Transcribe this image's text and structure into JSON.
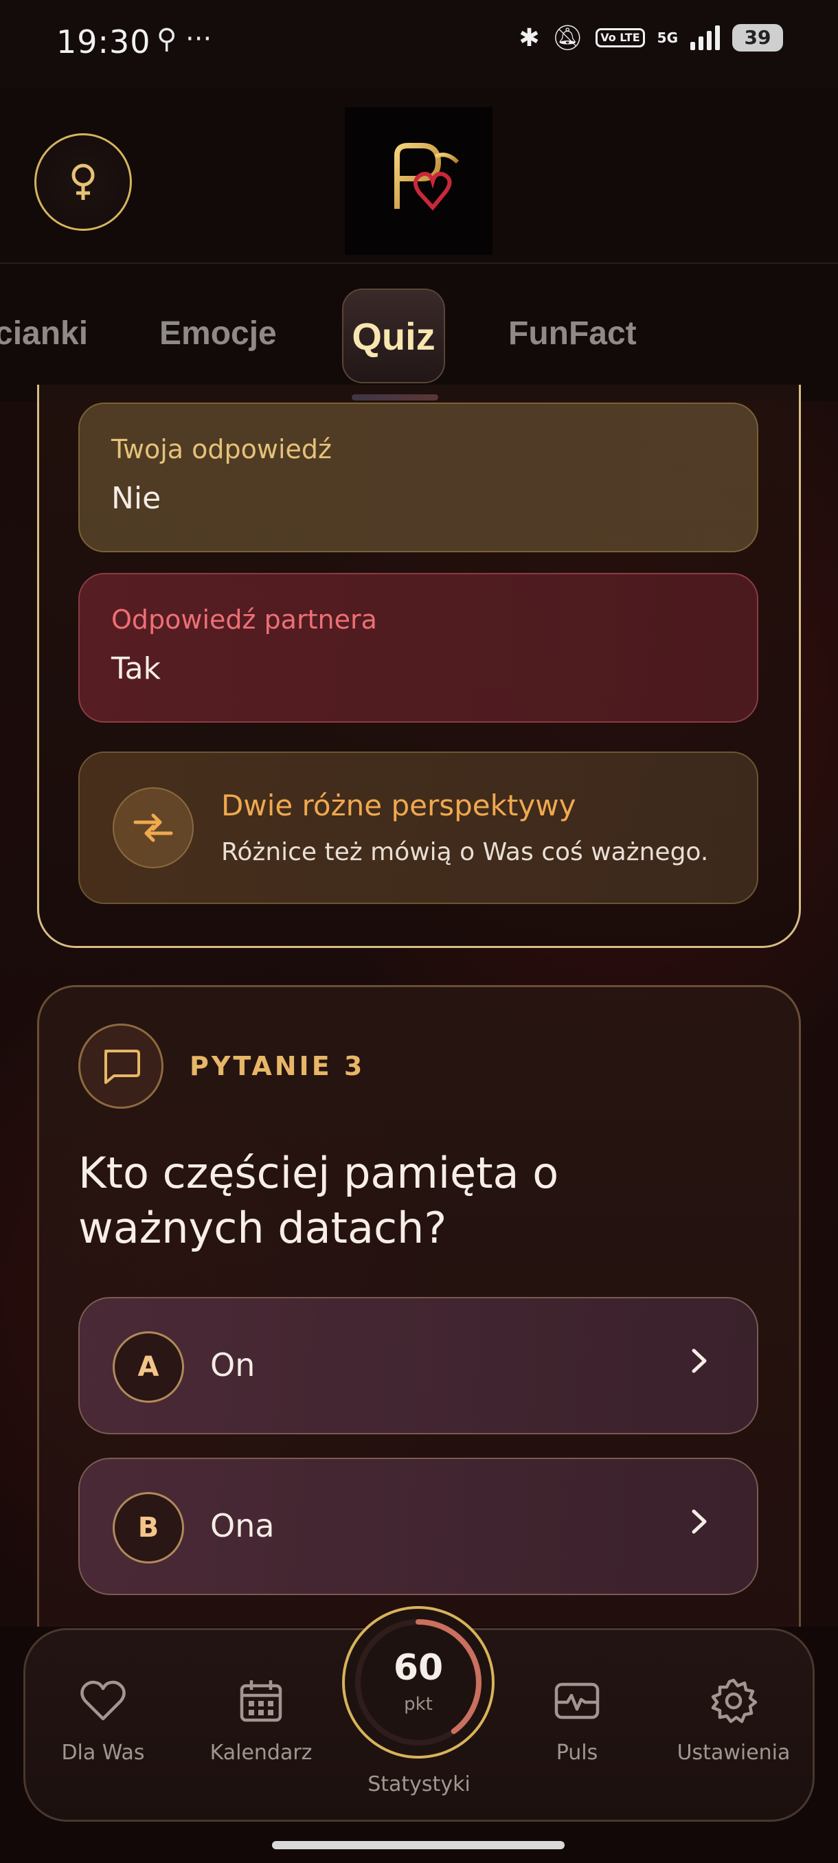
{
  "status_bar": {
    "time": "19:30",
    "left_icons": "⚲ ···",
    "network": "5G",
    "volte": "Vo LTE",
    "battery": "39"
  },
  "header": {
    "gender_icon": "female-icon",
    "logo_alt": "logo"
  },
  "tabs": {
    "items": [
      {
        "label": "cianki"
      },
      {
        "label": "Emocje"
      },
      {
        "label": "Quiz"
      },
      {
        "label": "FunFact"
      }
    ],
    "active": "Quiz"
  },
  "answers": {
    "mine": {
      "label": "Twoja odpowiedź",
      "value": "Nie"
    },
    "partner": {
      "label": "Odpowiedź partnera",
      "value": "Tak"
    },
    "perspective": {
      "title": "Dwie różne perspektywy",
      "subtitle": "Różnice też mówią o Was coś ważnego."
    }
  },
  "question": {
    "number_label": "PYTANIE 3",
    "text": "Kto częściej pamięta o ważnych datach?",
    "options": [
      {
        "letter": "A",
        "text": "On"
      },
      {
        "letter": "B",
        "text": "Ona"
      }
    ]
  },
  "bottom_nav": {
    "items": [
      {
        "label": "Dla Was",
        "icon": "heart-icon"
      },
      {
        "label": "Kalendarz",
        "icon": "calendar-icon"
      },
      {
        "label": "Puls",
        "icon": "pulse-icon"
      },
      {
        "label": "Ustawienia",
        "icon": "gear-icon"
      }
    ],
    "stats": {
      "value": "60",
      "unit": "pkt",
      "label": "Statystyki",
      "progress": 0.4
    }
  },
  "colors": {
    "gold": "#d8be85",
    "accent_orange": "#f0a94f",
    "partner_red": "#ee6f76"
  }
}
